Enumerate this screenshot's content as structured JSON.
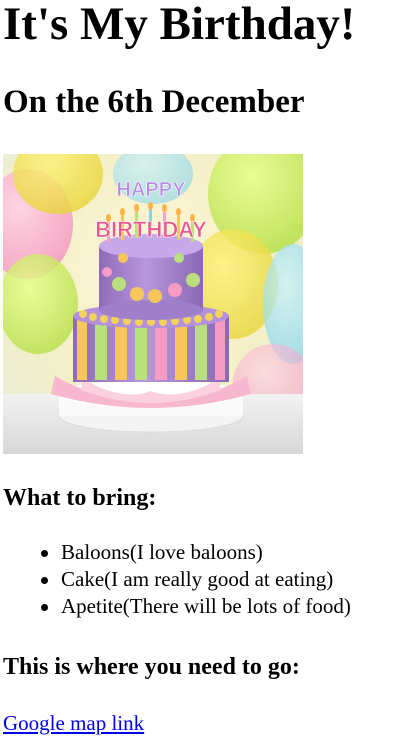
{
  "page": {
    "title": "It's My Birthday!",
    "date_heading": "On the 6th December",
    "bring_heading": "What to bring:",
    "bring_items": [
      "Baloons(I love baloons)",
      "Cake(I am really good at eating)",
      "Apetite(There will be lots of food)"
    ],
    "directions_heading": "This is where you need to go:",
    "map_link_text": "Google map link"
  },
  "image": {
    "topper_text_line1": "HAPPY",
    "topper_text_line2": "BIRTHDAY"
  }
}
